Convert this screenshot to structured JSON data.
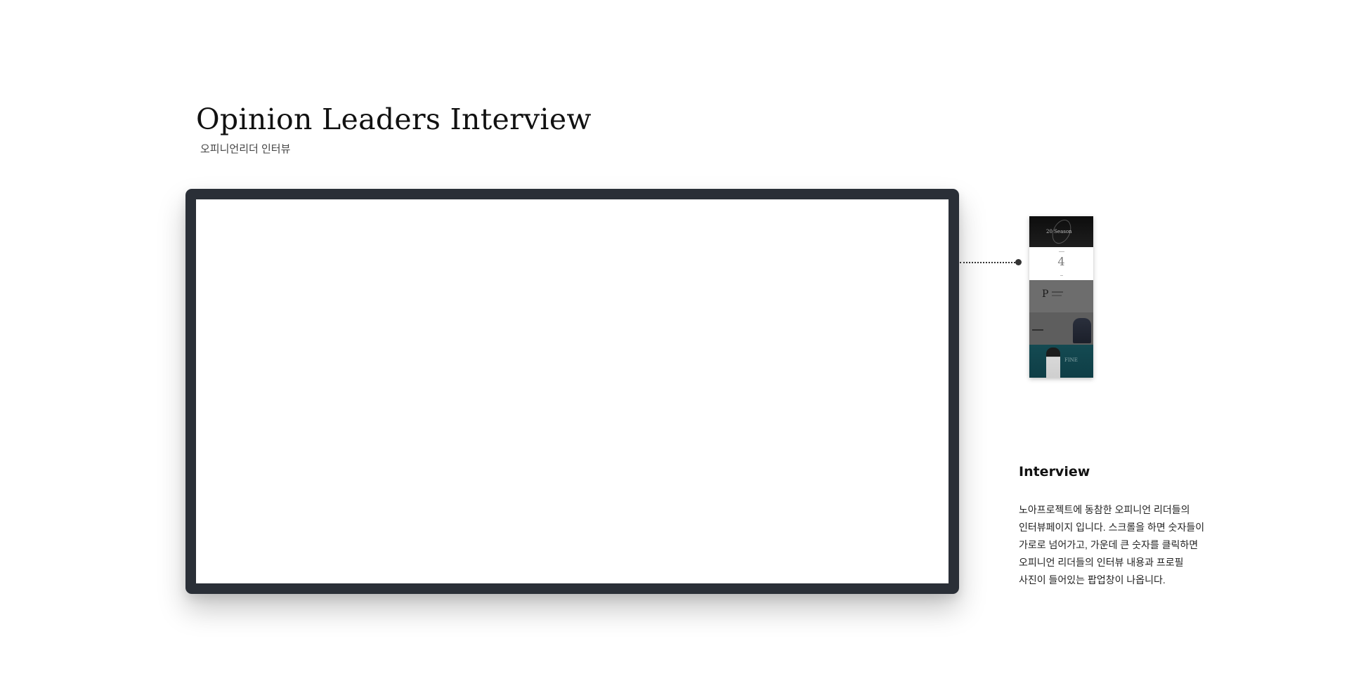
{
  "header": {
    "title": "Opinion Leaders Interview",
    "subtitle": "오피니언리더 인터뷰"
  },
  "preview": {
    "hero_text": "20 Season",
    "number": "4",
    "letter": "P",
    "word": "FINE"
  },
  "info": {
    "heading": "Interview",
    "lines": [
      "노아프로젝트에 동참한 오피니언 리더들의",
      "인터뷰페이지 입니다.  스크롤을 하면 숫자들이",
      "가로로 넘어가고, 가운데 큰 숫자를 클릭하면",
      "오피니언 리더들의 인터뷰 내용과 프로필",
      "사진이 들어있는 팝업창이 나옵니다."
    ]
  },
  "colors": {
    "monitor_frame": "#2a2f37",
    "screen": "#ffffff",
    "text": "#111111"
  }
}
